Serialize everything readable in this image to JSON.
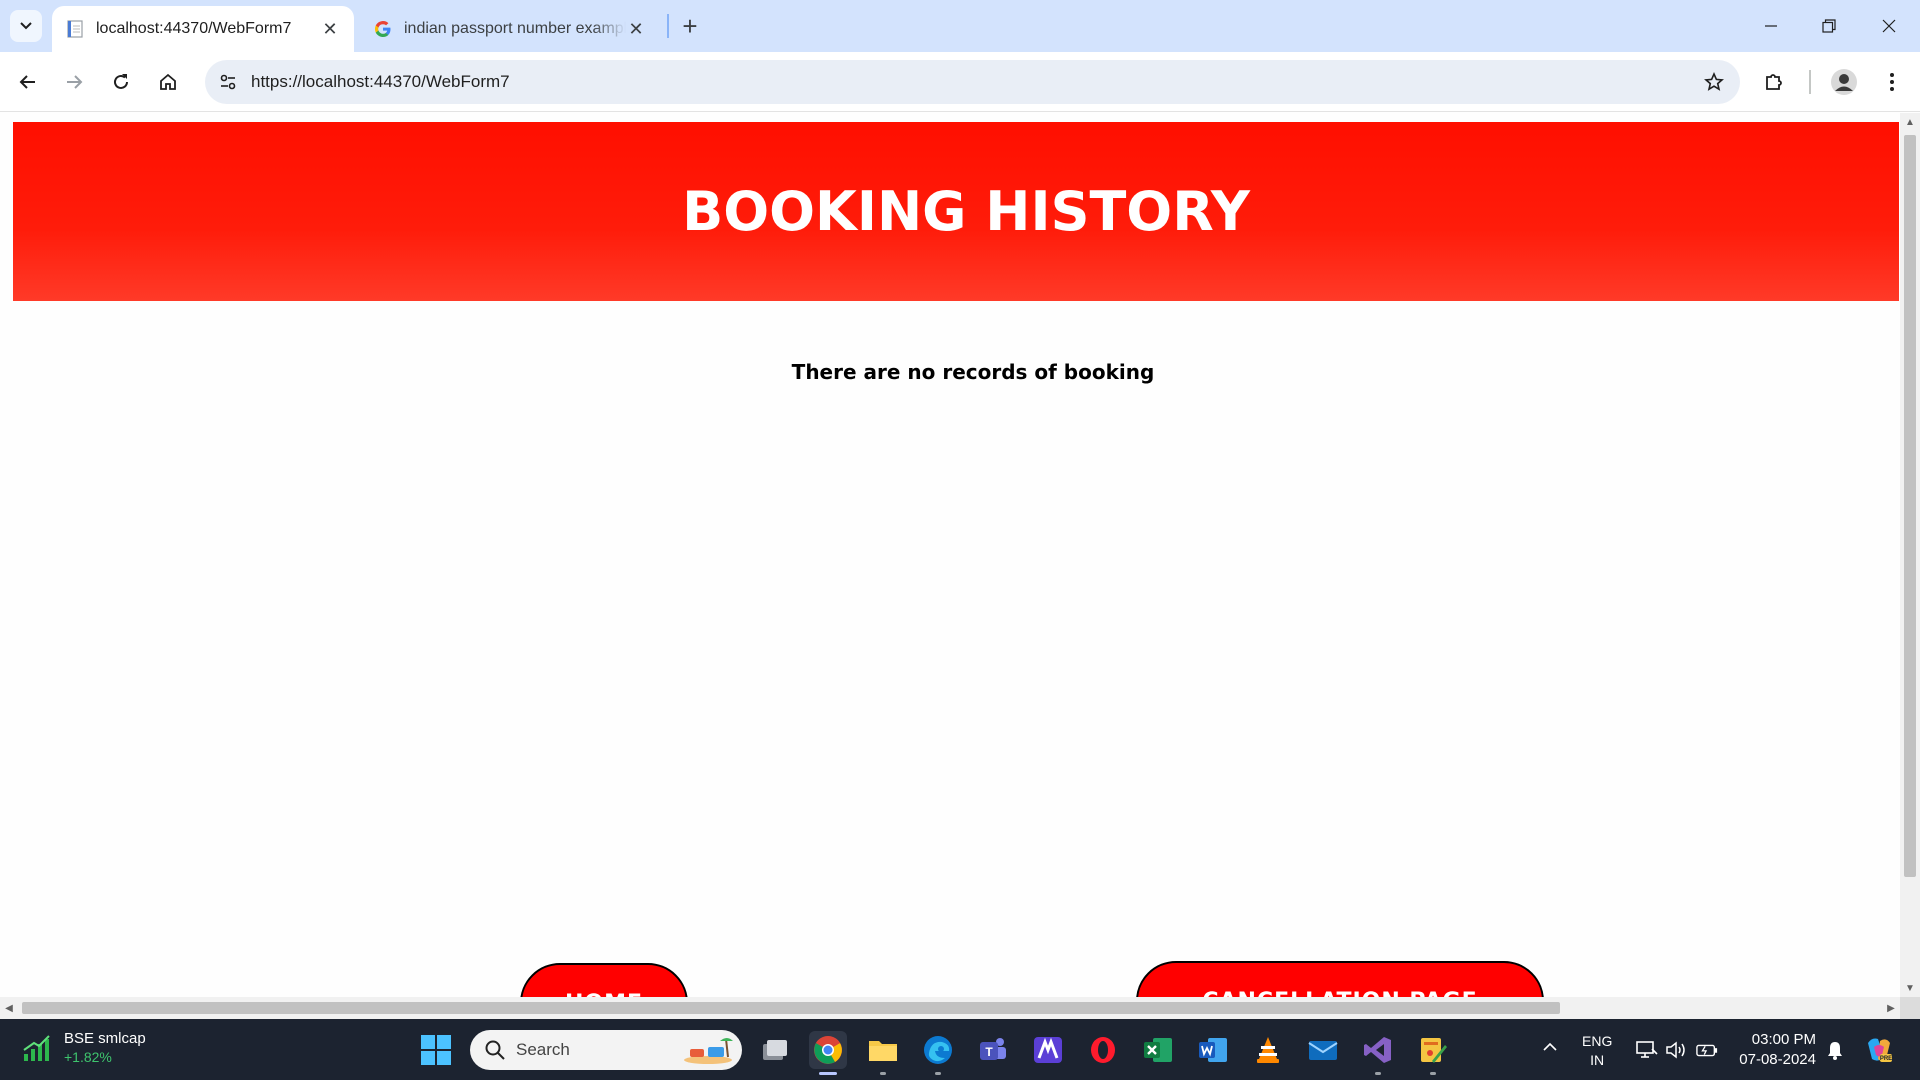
{
  "browser": {
    "tabs": [
      {
        "title": "localhost:44370/WebForm7",
        "active": true,
        "favicon": "page-icon"
      },
      {
        "title": "indian passport number example",
        "active": false,
        "favicon": "google-icon"
      }
    ],
    "url": "https://localhost:44370/WebForm7"
  },
  "page": {
    "title": "BOOKING HISTORY",
    "empty_message": "There are no records of booking",
    "home_button": "HOME",
    "cancellation_button": "CANCELLATION PAGE",
    "accent_color": "#ff0f00"
  },
  "taskbar": {
    "widget": {
      "name": "BSE smlcap",
      "change": "+1.82%"
    },
    "search_placeholder": "Search",
    "apps": [
      "task-view",
      "chrome",
      "file-explorer",
      "edge",
      "teams",
      "app-m",
      "opera",
      "excel",
      "word",
      "vlc",
      "mail",
      "visual-studio",
      "paint-app"
    ],
    "language": {
      "line1": "ENG",
      "line2": "IN"
    },
    "time": "03:00 PM",
    "date": "07-08-2024"
  }
}
